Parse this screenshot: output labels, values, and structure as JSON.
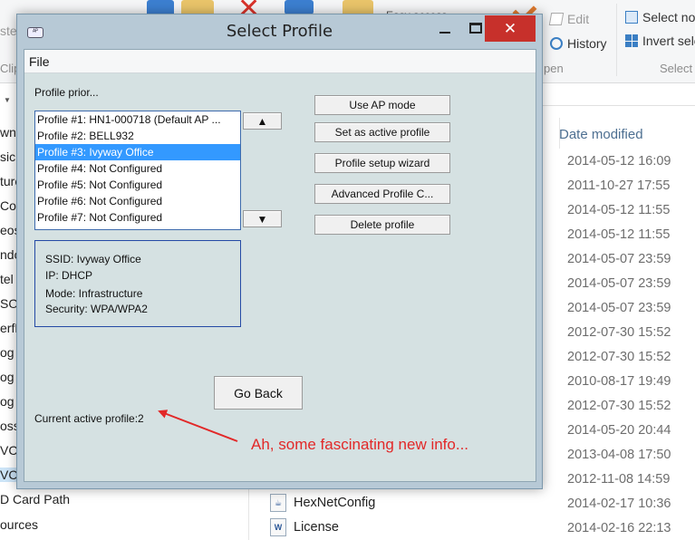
{
  "ribbon": {
    "edit_label": "Edit",
    "history_label": "History",
    "select_none_label": "Select no",
    "invert_select_label": "Invert sele",
    "open_group_label": "pen",
    "select_group_label": "Select",
    "clip_label": "Clip",
    "ste_label": "ste",
    "easy_access_label": "Easy access"
  },
  "nav_pane": {
    "items": [
      "wnl",
      "sic",
      "ture",
      "Cor",
      "eos",
      "ndo",
      "tel",
      "SO",
      "erfL",
      "og",
      "og",
      "og",
      "oss",
      "VC",
      "VC",
      "D Card Path",
      "ources"
    ]
  },
  "file_list": {
    "column_date": "Date modified",
    "dates": [
      "2014-05-12 16:09",
      "2011-10-27 17:55",
      "2014-05-12 11:55",
      "2014-05-12 11:55",
      "2014-05-07 23:59",
      "2014-05-07 23:59",
      "2014-05-07 23:59",
      "2012-07-30 15:52",
      "2012-07-30 15:52",
      "2010-08-17 19:49",
      "2012-07-30 15:52",
      "2014-05-20 20:44",
      "2013-04-08 17:50",
      "2012-11-08 14:59",
      "2014-02-17 10:36",
      "2014-02-16 22:13"
    ],
    "files": [
      {
        "name": "HexNetConfig",
        "icon": "java-icon"
      },
      {
        "name": "License",
        "icon": "word-doc-icon"
      }
    ]
  },
  "dialog": {
    "title": "Select Profile",
    "app_icon_text": "ᴬᴾ",
    "menu_file": "File",
    "profile_priority_label": "Profile prior...",
    "profiles": [
      "Profile #1: HN1-000718 (Default AP ...",
      "Profile #2: BELL932",
      "Profile #3: Ivyway Office",
      "Profile #4: Not Configured",
      "Profile #5: Not Configured",
      "Profile #6: Not Configured",
      "Profile #7: Not Configured"
    ],
    "selected_profile_index": 2,
    "move_up_glyph": "▲",
    "move_down_glyph": "▼",
    "buttons": {
      "use_ap_mode": "Use AP mode",
      "set_active": "Set as active profile",
      "setup_wizard": "Profile setup wizard",
      "advanced": "Advanced Profile C...",
      "delete": "Delete profile",
      "go_back": "Go Back"
    },
    "info": {
      "ssid": "SSID: Ivyway Office",
      "ip": "IP: DHCP",
      "mode": "Mode: Infrastructure",
      "security": "Security: WPA/WPA2"
    },
    "current_active_label": "Current active profile:",
    "current_active_value": "2"
  },
  "annotation": {
    "text": "Ah, some fascinating new info...",
    "color": "#e22828"
  }
}
